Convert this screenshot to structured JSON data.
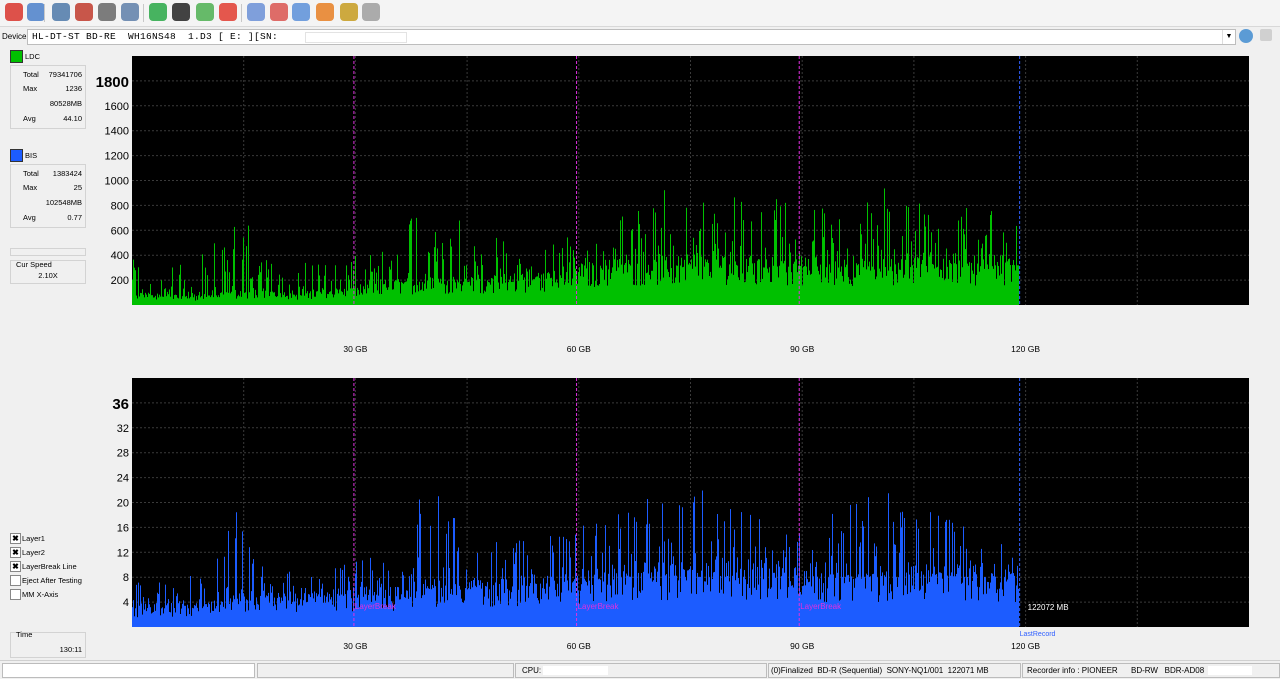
{
  "toolbar": {
    "buttons": [
      {
        "name": "exit-icon",
        "color": "#d8342c"
      },
      {
        "name": "wand-icon",
        "color": "#4a7fc9"
      },
      {
        "name": "monitor-icon",
        "color": "#4c78a8"
      },
      {
        "name": "drive-red-icon",
        "color": "#c0392b"
      },
      {
        "name": "drive-gray-icon",
        "color": "#666666"
      },
      {
        "name": "compare-icon",
        "color": "#5d7ea8"
      },
      {
        "name": "refresh-icon",
        "color": "#28a745"
      },
      {
        "name": "disc-icon",
        "color": "#222222"
      },
      {
        "name": "shield-disc-icon",
        "color": "#4caf50"
      },
      {
        "name": "stop-icon",
        "color": "#e03b2f"
      },
      {
        "name": "blue-disc-icon",
        "color": "#6a8fd6"
      },
      {
        "name": "eraser-icon",
        "color": "#d9534f"
      },
      {
        "name": "globe-icon",
        "color": "#5a8fd8"
      },
      {
        "name": "fire-icon",
        "color": "#e67e22"
      },
      {
        "name": "chart-icon",
        "color": "#c59b1e"
      },
      {
        "name": "save-icon",
        "color": "#9e9e9e"
      }
    ]
  },
  "device": {
    "label": "Device:",
    "value": "HL-DT-ST BD-RE  WH16NS48  1.D3 [ E: ][SN:                ]"
  },
  "ldc": {
    "label": "LDC",
    "color": "#00c000",
    "stats": [
      {
        "k": "Total",
        "v": "79341706"
      },
      {
        "k": "Max",
        "v": "1236"
      },
      {
        "k": "",
        "v": "80528MB"
      },
      {
        "k": "Avg",
        "v": "44.10"
      }
    ]
  },
  "bis": {
    "label": "BIS",
    "color": "#1c5cff",
    "stats": [
      {
        "k": "Total",
        "v": "1383424"
      },
      {
        "k": "Max",
        "v": "25"
      },
      {
        "k": "",
        "v": "102548MB"
      },
      {
        "k": "Avg",
        "v": "0.77"
      }
    ]
  },
  "speed": {
    "label": "Cur Speed",
    "value": "2.10X"
  },
  "options": [
    {
      "label": "Layer1",
      "checked": true
    },
    {
      "label": "Layer2",
      "checked": true
    },
    {
      "label": "LayerBreak Line",
      "checked": true
    },
    {
      "label": "Eject After Testing",
      "checked": false
    },
    {
      "label": "MM X-Axis",
      "checked": false
    }
  ],
  "time": {
    "label": "Time",
    "value": "130:11"
  },
  "chart_data": [
    {
      "type": "bar",
      "title": "LDC",
      "xlabel": "",
      "ylabel": "",
      "xlim": [
        0,
        150
      ],
      "ylim": [
        0,
        2000
      ],
      "x_ticks": [
        "30 GB",
        "60 GB",
        "90 GB",
        "120 GB"
      ],
      "x_tick_values": [
        30,
        60,
        90,
        120
      ],
      "y_ticks": [
        "200",
        "400",
        "600",
        "800",
        "1000",
        "1200",
        "1400",
        "1600",
        "1800"
      ],
      "y_tick_values": [
        200,
        400,
        600,
        800,
        1000,
        1200,
        1400,
        1600,
        1800
      ],
      "layer_breaks": [
        29.8,
        59.7,
        89.6
      ],
      "last_record": 119.2,
      "series": [
        {
          "name": "LDC",
          "color": "#00c000",
          "profile": [
            [
              0,
              80,
              420
            ],
            [
              5,
              70,
              330
            ],
            [
              10,
              70,
              430
            ],
            [
              14,
              90,
              930
            ],
            [
              18,
              110,
              420
            ],
            [
              22,
              80,
              410
            ],
            [
              26,
              110,
              350
            ],
            [
              30,
              110,
              450
            ],
            [
              35,
              160,
              500
            ],
            [
              40,
              180,
              1180
            ],
            [
              45,
              180,
              620
            ],
            [
              50,
              180,
              560
            ],
            [
              55,
              200,
              560
            ],
            [
              60,
              260,
              650
            ],
            [
              65,
              300,
              720
            ],
            [
              70,
              310,
              980
            ],
            [
              75,
              300,
              800
            ],
            [
              80,
              320,
              880
            ],
            [
              85,
              300,
              900
            ],
            [
              90,
              310,
              860
            ],
            [
              95,
              300,
              760
            ],
            [
              100,
              300,
              1230
            ],
            [
              105,
              320,
              820
            ],
            [
              110,
              300,
              900
            ],
            [
              115,
              310,
              780
            ],
            [
              119,
              320,
              680
            ]
          ]
        }
      ]
    },
    {
      "type": "bar",
      "title": "BIS",
      "xlabel": "",
      "ylabel": "",
      "xlim": [
        0,
        150
      ],
      "ylim": [
        0,
        40
      ],
      "x_ticks": [
        "30 GB",
        "60 GB",
        "90 GB",
        "120 GB"
      ],
      "x_tick_values": [
        30,
        60,
        90,
        120
      ],
      "y_ticks": [
        "4",
        "8",
        "12",
        "16",
        "20",
        "24",
        "28",
        "32",
        "36"
      ],
      "y_tick_values": [
        4,
        8,
        12,
        16,
        20,
        24,
        28,
        32,
        36
      ],
      "layer_breaks": [
        29.8,
        59.7,
        89.6
      ],
      "last_record": 119.2,
      "layer_break_label": "LayerBreak",
      "last_record_label": "LastRecord",
      "last_record_value": "122072 MB",
      "series": [
        {
          "name": "BIS",
          "color": "#1c5cff",
          "profile": [
            [
              0,
              3,
              8
            ],
            [
              5,
              3,
              7
            ],
            [
              10,
              3,
              10
            ],
            [
              14,
              4,
              19
            ],
            [
              18,
              5,
              10
            ],
            [
              22,
              4,
              9
            ],
            [
              26,
              5,
              10
            ],
            [
              30,
              5,
              11
            ],
            [
              35,
              5,
              12
            ],
            [
              40,
              6,
              24
            ],
            [
              45,
              6,
              15
            ],
            [
              50,
              6,
              14
            ],
            [
              55,
              7,
              15
            ],
            [
              60,
              7,
              16
            ],
            [
              65,
              8,
              19
            ],
            [
              70,
              8,
              22
            ],
            [
              75,
              8,
              23
            ],
            [
              80,
              8,
              20
            ],
            [
              85,
              8,
              19
            ],
            [
              90,
              8,
              19
            ],
            [
              95,
              8,
              18
            ],
            [
              100,
              8,
              25
            ],
            [
              105,
              8,
              18
            ],
            [
              110,
              8,
              20
            ],
            [
              115,
              8,
              17
            ],
            [
              119,
              8,
              14
            ]
          ]
        }
      ]
    }
  ],
  "statusbar": {
    "cpu_label": "CPU:",
    "disc_info": "(0)Finalized  BD-R (Sequential)  SONY-NQ1/001  122071 MB",
    "recorder_label": "Recorder info : PIONEER",
    "recorder_model": "BD-RW   BDR-AD08"
  }
}
